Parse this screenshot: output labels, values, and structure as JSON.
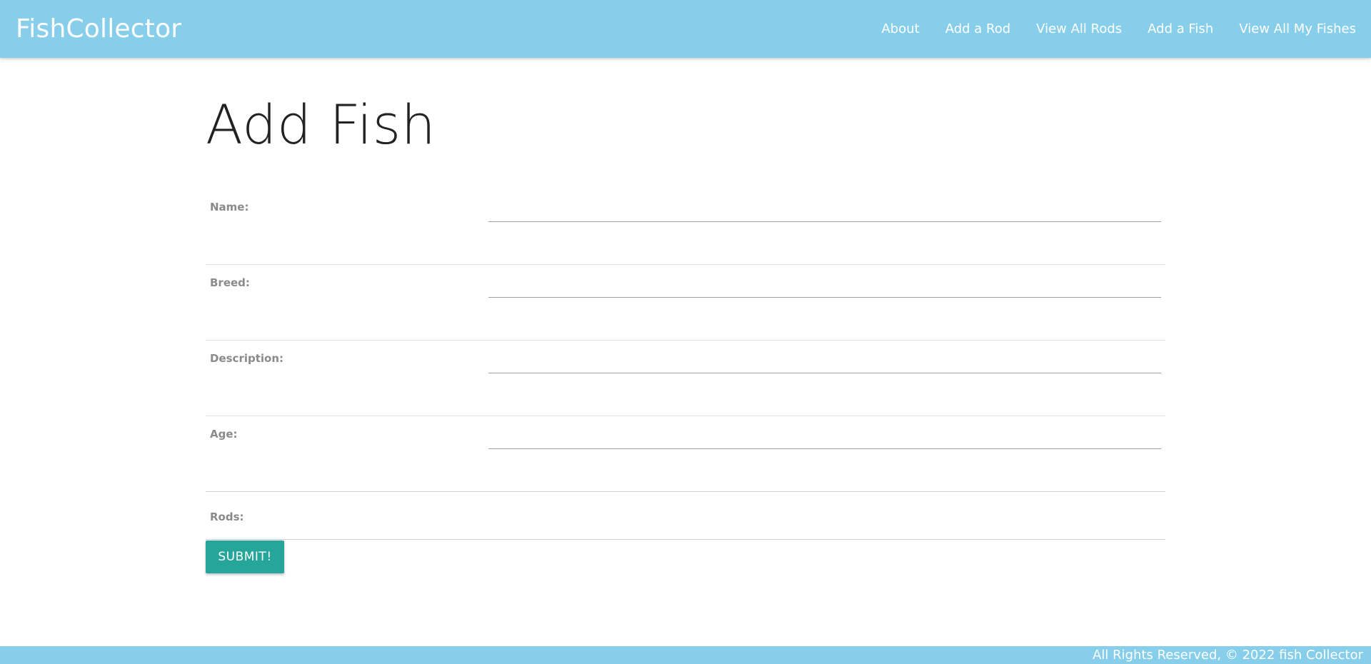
{
  "nav": {
    "brand": "FishCollector",
    "links": [
      "About",
      "Add a Rod",
      "View All Rods",
      "Add a Fish",
      "View All My Fishes"
    ]
  },
  "page": {
    "title": "Add Fish"
  },
  "form": {
    "fields": [
      {
        "label": "Name:",
        "value": ""
      },
      {
        "label": "Breed:",
        "value": ""
      },
      {
        "label": "Description:",
        "value": ""
      },
      {
        "label": "Age:",
        "value": ""
      }
    ],
    "rods_label": "Rods:",
    "submit_label": "SUBMIT!"
  },
  "footer": {
    "text": "All Rights Reserved, © 2022 fish Collector"
  },
  "colors": {
    "nav_bg": "#87ceeb",
    "accent": "#26a69a"
  }
}
